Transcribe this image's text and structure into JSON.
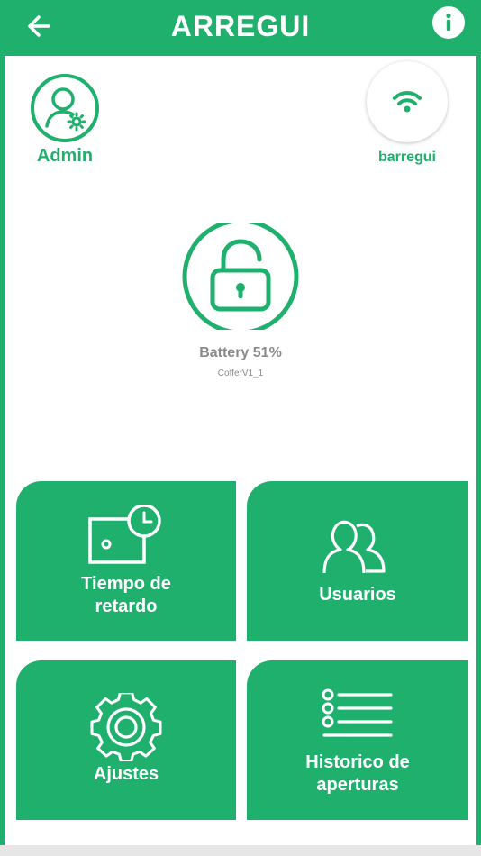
{
  "app": {
    "brand_text": "ARREGUI",
    "accent_color": "#1fb06d",
    "header": {
      "back_icon": "arrow-left-icon",
      "info_icon": "info-icon"
    }
  },
  "user": {
    "label": "Admin",
    "icon": "user-settings-icon"
  },
  "network": {
    "label": "barregui",
    "icon": "wifi-icon"
  },
  "lock": {
    "state_icon": "lock-open-icon",
    "battery_text": "Battery 51%",
    "battery_percent": 51,
    "device_name": "CofferV1_1"
  },
  "tiles": [
    {
      "label": "Tiempo de\nretardo",
      "icon": "timer-box-icon"
    },
    {
      "label": "Usuarios",
      "icon": "users-icon"
    },
    {
      "label": "Ajustes",
      "icon": "gear-icon"
    },
    {
      "label": "Historico de\naperturas",
      "icon": "list-icon"
    }
  ]
}
